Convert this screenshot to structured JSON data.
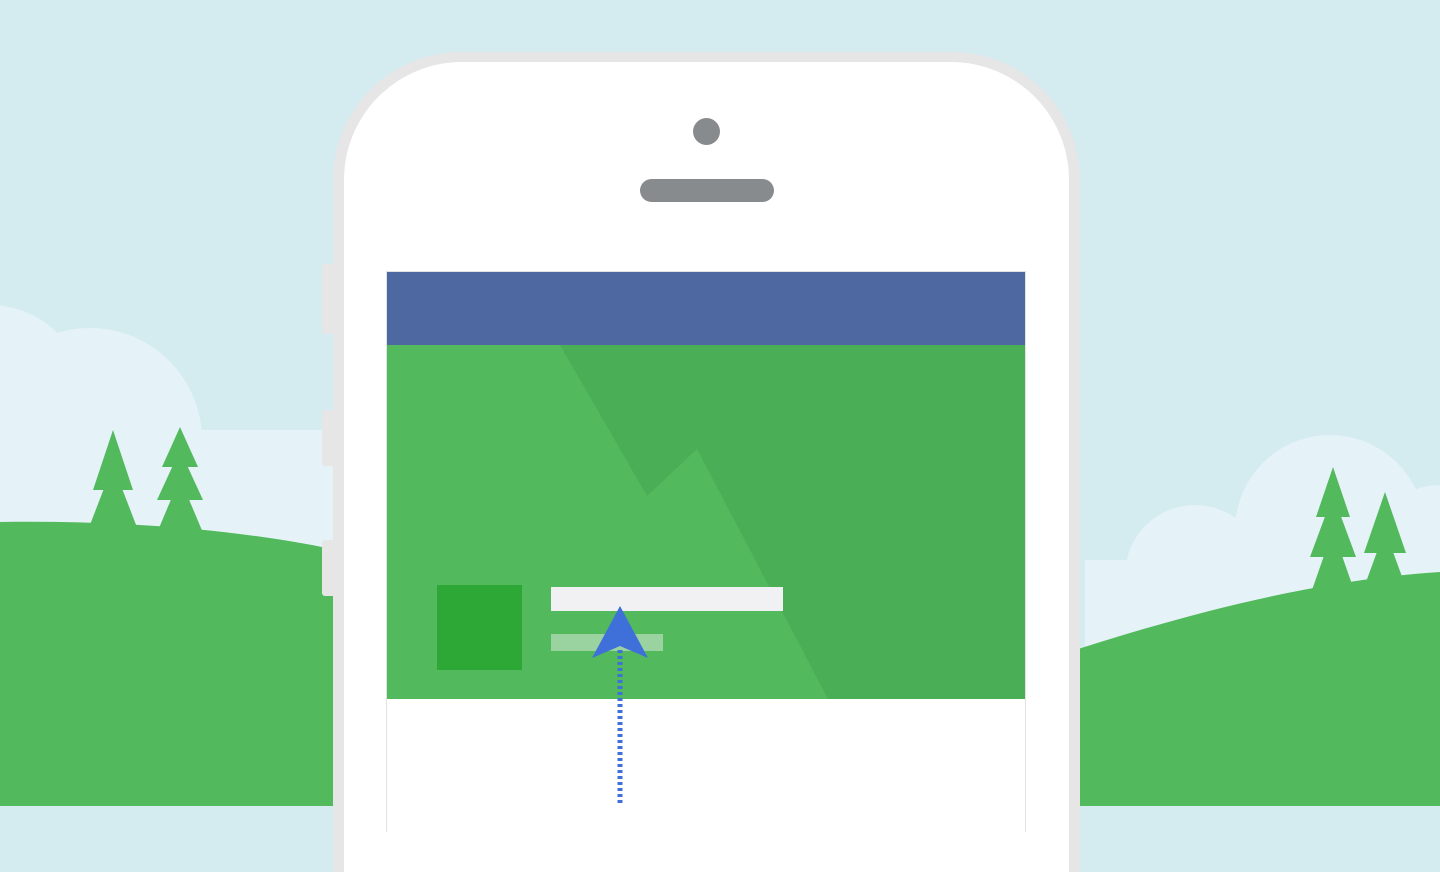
{
  "colors": {
    "sky": "#d4ebf0",
    "cloud": "#e5f3f8",
    "hill": "#52b95c",
    "tree": "#52b95c",
    "phone_frame": "#e6e6e6",
    "phone_face": "#ffffff",
    "camera_speaker": "#888b8e",
    "nav_bar": "#4e68a1",
    "cover_light": "#52b95c",
    "cover_dark": "#4aae57",
    "profile_picture": "#2da836",
    "placeholder_bar": "#f1f1f3",
    "pointer_arrow": "#3f6fd9"
  },
  "icons": {
    "pointer": "arrow-up-icon"
  }
}
